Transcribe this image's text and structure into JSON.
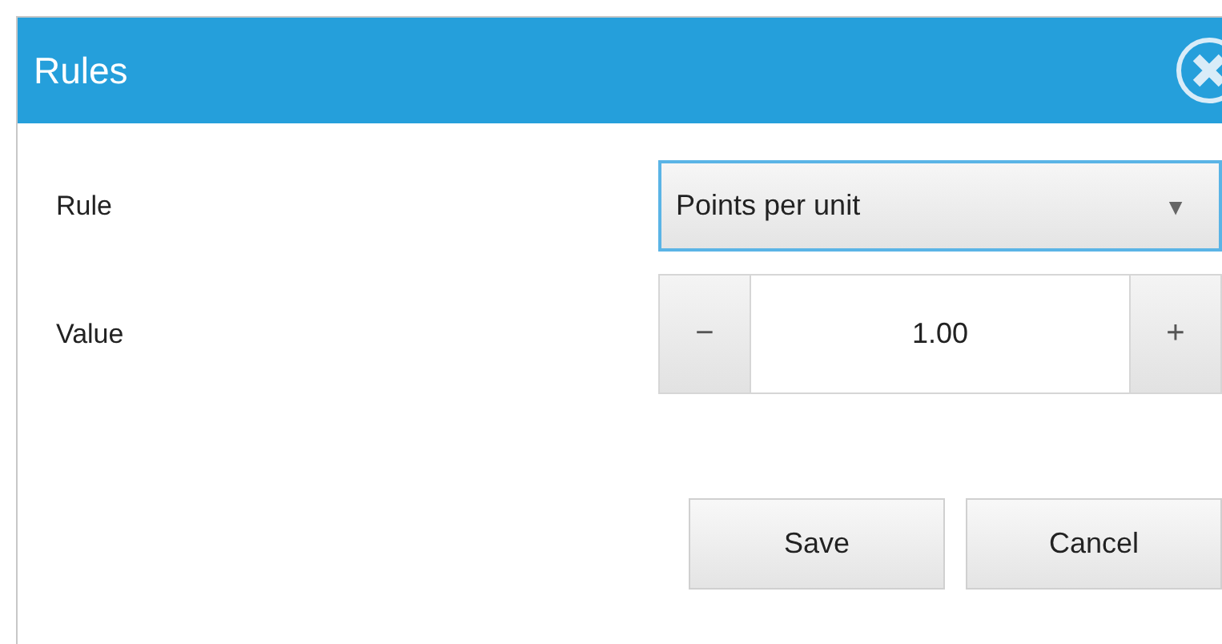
{
  "window": {
    "title": "Rules"
  },
  "fields": [
    {
      "kind": "dropdown",
      "label": "Rule",
      "value": "Points per unit",
      "arrow": "▼",
      "focused": true
    },
    {
      "kind": "stepper",
      "label": "Value",
      "value": "1.00",
      "decrement": "−",
      "increment": "+"
    }
  ],
  "buttons": [
    "Save",
    "Cancel"
  ]
}
